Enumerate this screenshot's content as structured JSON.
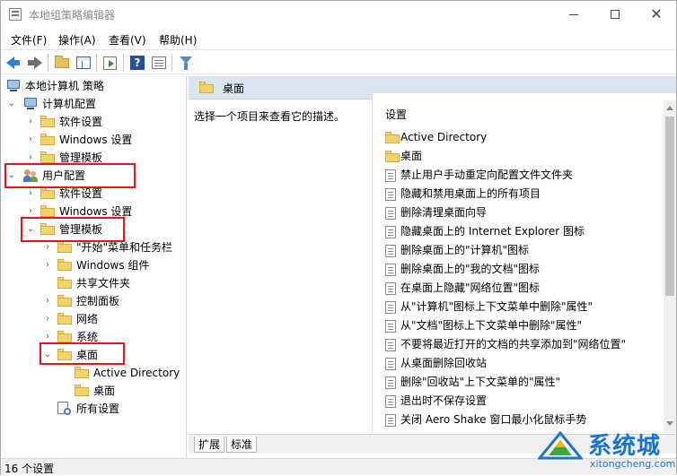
{
  "window": {
    "title": "本地组策略编辑器"
  },
  "menu": {
    "items": [
      "文件(F)",
      "操作(A)",
      "查看(V)",
      "帮助(H)"
    ]
  },
  "toolbar": {
    "icons": [
      "back-arrow-icon",
      "forward-arrow-icon",
      "up-folder-icon",
      "show-hide-tree-icon",
      "export-list-icon",
      "help-icon",
      "properties-icon",
      "filter-icon"
    ]
  },
  "tree": {
    "root": "本地计算机 策略",
    "computer_config": "计算机配置",
    "cc_software": "软件设置",
    "cc_windows": "Windows 设置",
    "cc_admin": "管理模板",
    "user_config": "用户配置",
    "uc_software": "软件设置",
    "uc_windows": "Windows 设置",
    "uc_admin": "管理模板",
    "start_menu": "\"开始\"菜单和任务栏",
    "windows_components": "Windows 组件",
    "shared_folders": "共享文件夹",
    "control_panel": "控制面板",
    "network": "网络",
    "system": "系统",
    "desktop": "桌面",
    "active_directory": "Active Directory",
    "desktop_sub": "桌面",
    "all_settings": "所有设置"
  },
  "right": {
    "header_title": "桌面",
    "description": "选择一个项目来查看它的描述。",
    "column_header": "设置",
    "items": [
      {
        "type": "folder",
        "label": "Active Directory"
      },
      {
        "type": "folder",
        "label": "桌面"
      },
      {
        "type": "setting",
        "label": "禁止用户手动重定向配置文件文件夹"
      },
      {
        "type": "setting",
        "label": "隐藏和禁用桌面上的所有项目"
      },
      {
        "type": "setting",
        "label": "删除清理桌面向导"
      },
      {
        "type": "setting",
        "label": "隐藏桌面上的 Internet Explorer 图标"
      },
      {
        "type": "setting",
        "label": "删除桌面上的\"计算机\"图标"
      },
      {
        "type": "setting",
        "label": "删除桌面上的\"我的文档\"图标"
      },
      {
        "type": "setting",
        "label": "在桌面上隐藏\"网络位置\"图标"
      },
      {
        "type": "setting",
        "label": "从\"计算机\"图标上下文菜单中删除\"属性\""
      },
      {
        "type": "setting",
        "label": "从\"文档\"图标上下文菜单中删除\"属性\""
      },
      {
        "type": "setting",
        "label": "不要将最近打开的文档的共享添加到\"网络位置\""
      },
      {
        "type": "setting",
        "label": "从桌面删除回收站"
      },
      {
        "type": "setting",
        "label": "删除\"回收站\"上下文菜单的\"属性\""
      },
      {
        "type": "setting",
        "label": "退出时不保存设置"
      },
      {
        "type": "setting",
        "label": "关闭 Aero Shake 窗口最小化鼠标手势"
      }
    ]
  },
  "tabs": [
    "扩展",
    "标准"
  ],
  "status": {
    "text": "16 个设置"
  },
  "watermark": {
    "brand": "系统城",
    "url": "xitongcheng.com"
  },
  "colors": {
    "highlight_border": "#e8141b",
    "header_bg": "#dae5f2",
    "watermark_blue": "#1a73d2"
  }
}
